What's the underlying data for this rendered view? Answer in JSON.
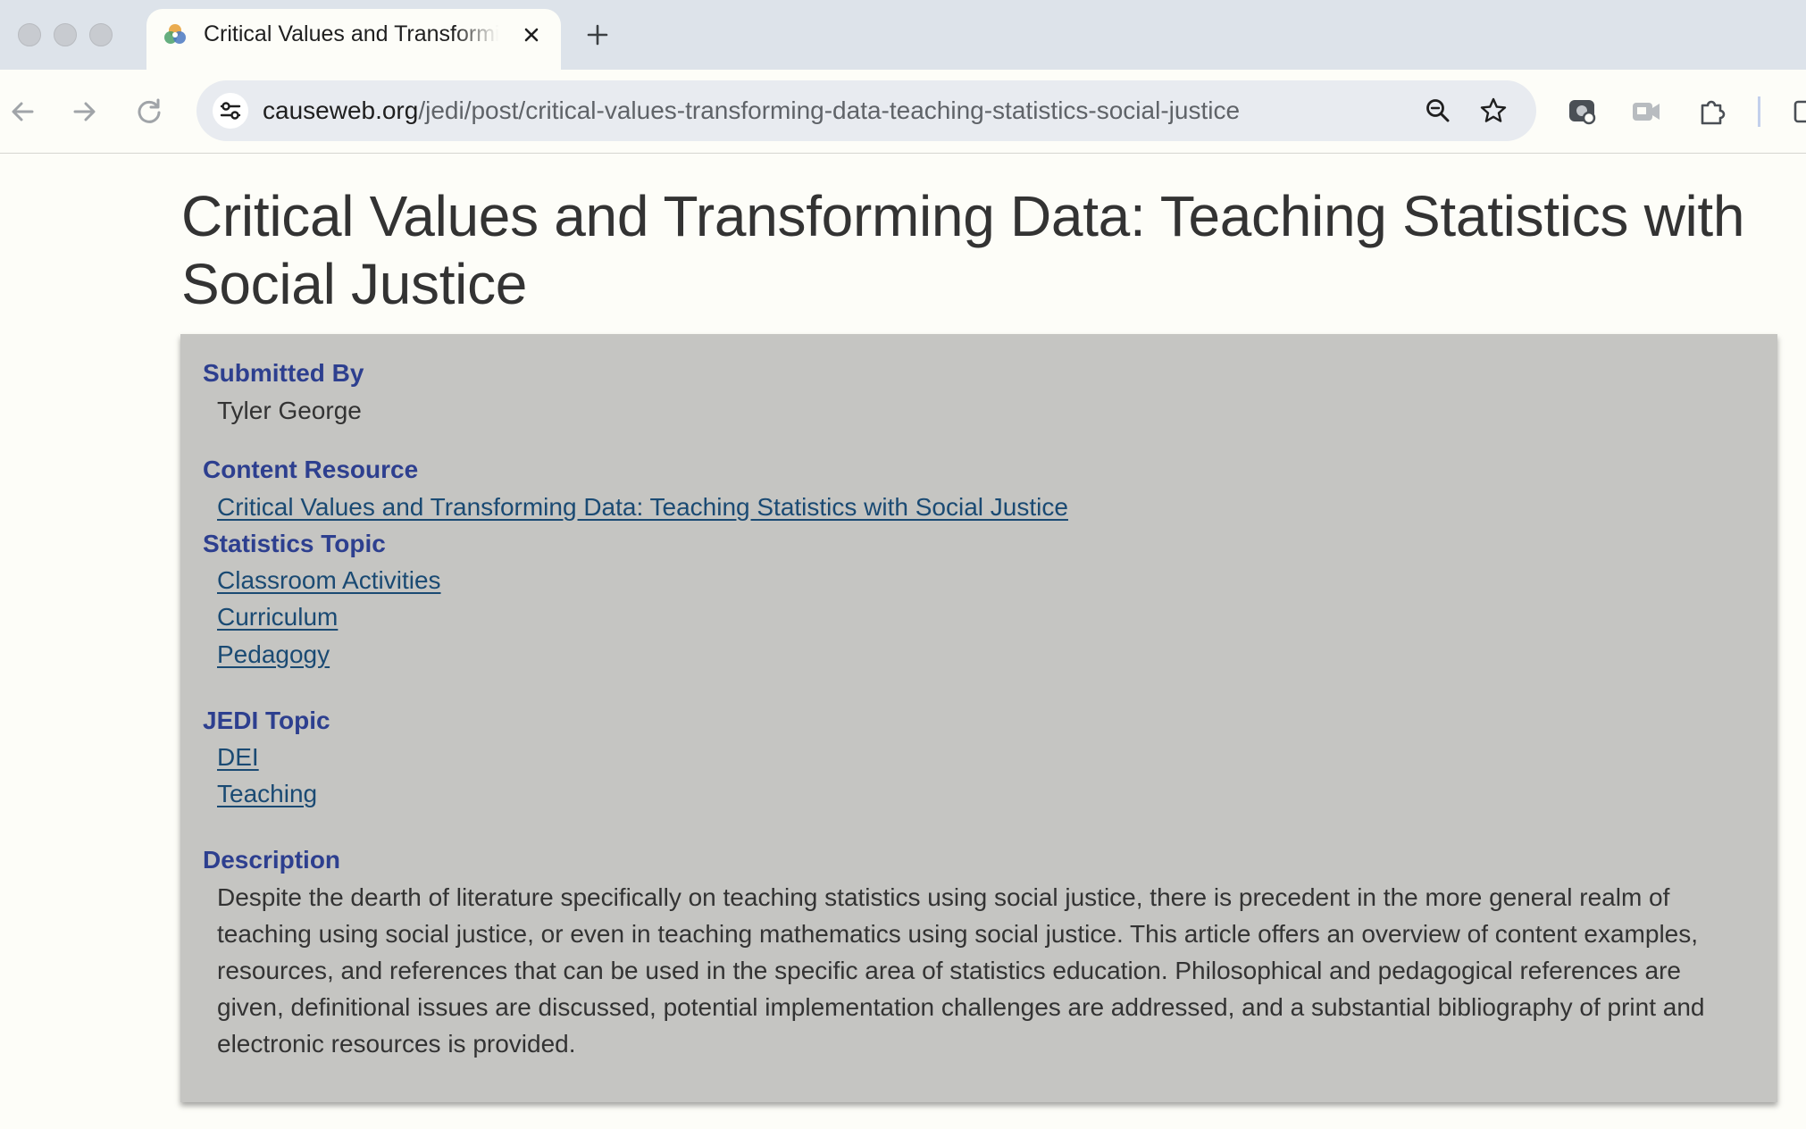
{
  "browser": {
    "tab_title": "Critical Values and Transforming Data: Teaching Statistics with Social Justice",
    "url_host": "causeweb.org",
    "url_path": "/jedi/post/critical-values-transforming-data-teaching-statistics-social-justice"
  },
  "page": {
    "title": "Critical Values and Transforming Data: Teaching Statistics with Social Justice",
    "submitted_by": {
      "label": "Submitted By",
      "value": "Tyler George"
    },
    "content_resource": {
      "label": "Content Resource",
      "link": "Critical Values and Transforming Data: Teaching Statistics with Social Justice"
    },
    "statistics_topic": {
      "label": "Statistics Topic",
      "items": [
        "Classroom Activities",
        "Curriculum",
        "Pedagogy"
      ]
    },
    "jedi_topic": {
      "label": "JEDI Topic",
      "items": [
        "DEI",
        "Teaching"
      ]
    },
    "description": {
      "label": "Description",
      "text": "Despite the dearth of literature specifically on teaching statistics using social justice, there is precedent in the more general realm of teaching using social justice, or even in teaching mathematics using social justice. This article offers an overview of content examples, resources, and references that can be used in the specific area of statistics education. Philosophical and pedagogical references are given, definitional issues are discussed, potential implementation challenges are addressed, and a substantial bibliography of print and electronic resources is provided."
    }
  },
  "colors": {
    "heading_blue": "#2d3f8f",
    "link_blue": "#1a4a73",
    "panel_gray": "#c5c5c2",
    "page_bg": "#fdfdf8"
  }
}
